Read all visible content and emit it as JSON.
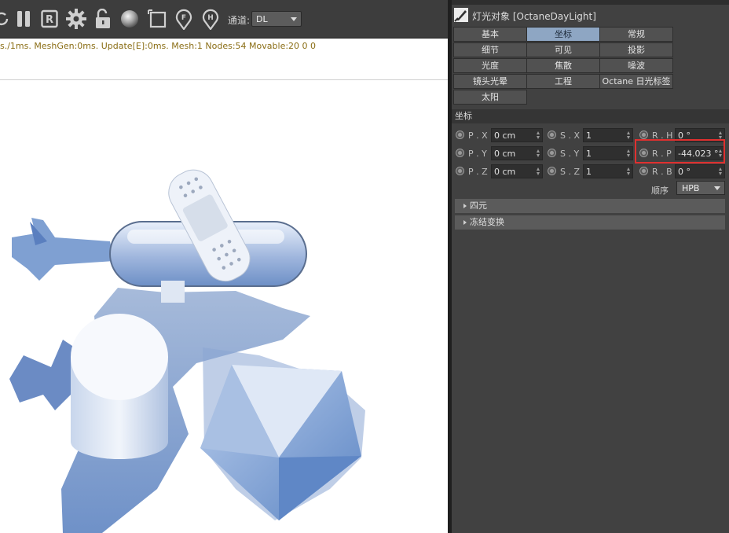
{
  "toolbar": {
    "icons": [
      "refresh-icon",
      "pause-icon",
      "render-region-icon",
      "settings-gear-icon",
      "unlock-icon",
      "sphere-icon",
      "frame-icon",
      "pin-f-icon",
      "pin-h-icon"
    ],
    "channel_label": "通道:",
    "channel_value": "DL"
  },
  "viewport": {
    "status_text": "s./1ms. MeshGen:0ms. Update[E]:0ms. Mesh:1 Nodes:54 Movable:20  0 0"
  },
  "attributes": {
    "title": "灯光对象 [OctaneDayLight]",
    "tabs": [
      {
        "label": "基本",
        "active": false
      },
      {
        "label": "坐标",
        "active": true
      },
      {
        "label": "常规",
        "active": false
      },
      {
        "label": "细节",
        "active": false
      },
      {
        "label": "可见",
        "active": false
      },
      {
        "label": "投影",
        "active": false
      },
      {
        "label": "光度",
        "active": false
      },
      {
        "label": "焦散",
        "active": false
      },
      {
        "label": "噪波",
        "active": false
      },
      {
        "label": "镜头光晕",
        "active": false
      },
      {
        "label": "工程",
        "active": false
      },
      {
        "label": "Octane 日光标签",
        "active": false
      },
      {
        "label": "太阳",
        "active": false
      }
    ],
    "section_title": "坐标",
    "coords": {
      "px": {
        "label": "P . X",
        "value": "0 cm"
      },
      "py": {
        "label": "P . Y",
        "value": "0 cm"
      },
      "pz": {
        "label": "P . Z",
        "value": "0 cm"
      },
      "sx": {
        "label": "S . X",
        "value": "1"
      },
      "sy": {
        "label": "S . Y",
        "value": "1"
      },
      "sz": {
        "label": "S . Z",
        "value": "1"
      },
      "rh": {
        "label": "R . H",
        "value": "0 °"
      },
      "rp": {
        "label": "R . P",
        "value": "-44.023 °"
      },
      "rb": {
        "label": "R . B",
        "value": "0 °"
      }
    },
    "order_label": "顺序",
    "order_value": "HPB",
    "groups": [
      "四元",
      "冻结变换"
    ]
  }
}
